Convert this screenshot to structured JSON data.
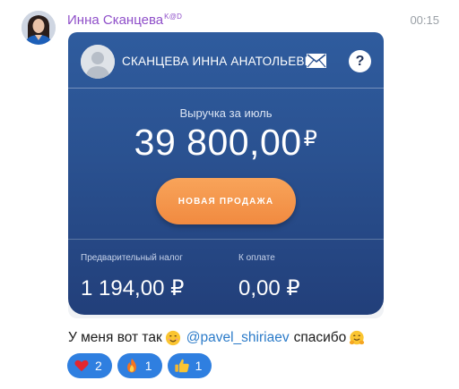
{
  "message": {
    "sender_name": "Инна Сканцева",
    "sender_tag": "K@D",
    "time": "00:15",
    "text_before": "У меня вот так",
    "mention": "@pavel_shiriaev",
    "text_after": "спасибо"
  },
  "card": {
    "profile_name": "СКАНЦЕВА ИННА АНАТОЛЬЕВНА",
    "help_label": "?",
    "revenue_label": "Выручка за июль",
    "revenue_amount": "39 800,00",
    "currency": "₽",
    "new_sale_button": "НОВАЯ ПРОДАЖА",
    "tax_label": "Предварительный налог",
    "tax_value": "1 194,00 ₽",
    "payment_label": "К оплате",
    "payment_value": "0,00 ₽"
  },
  "reactions": [
    {
      "icon": "heart-icon",
      "count": "2"
    },
    {
      "icon": "fire-icon",
      "count": "1"
    },
    {
      "icon": "thumbs-up-icon",
      "count": "1"
    }
  ],
  "colors": {
    "sender": "#8f4fc9",
    "card_top": "#2f5c9e",
    "card_bottom": "#223f7a",
    "button": "#f18a40",
    "mention": "#2b7bc9",
    "reaction_bg": "#2f7fe0"
  }
}
